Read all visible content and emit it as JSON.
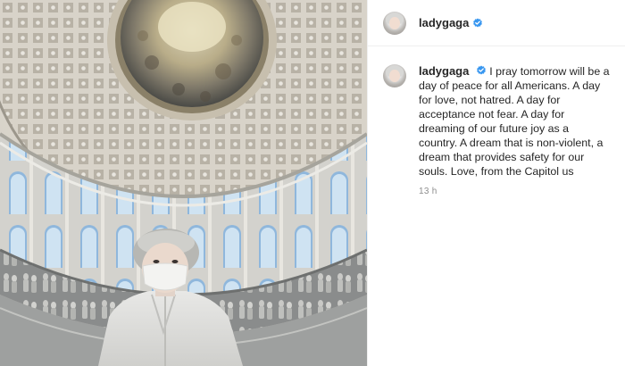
{
  "post": {
    "username": "ladygaga",
    "verified_icon": "verified-badge-icon",
    "caption": "I pray tomorrow will be a day of peace for all Americans. A day for love, not hatred. A day for acceptance not fear. A day for dreaming of our future joy as a country. A dream that is non-violent, a dream that provides safety for our souls. Love, from the Capitol us",
    "timestamp": "13 h"
  },
  "colors": {
    "verified": "#3897f0",
    "text": "#262626",
    "muted": "#8e8e8e"
  }
}
